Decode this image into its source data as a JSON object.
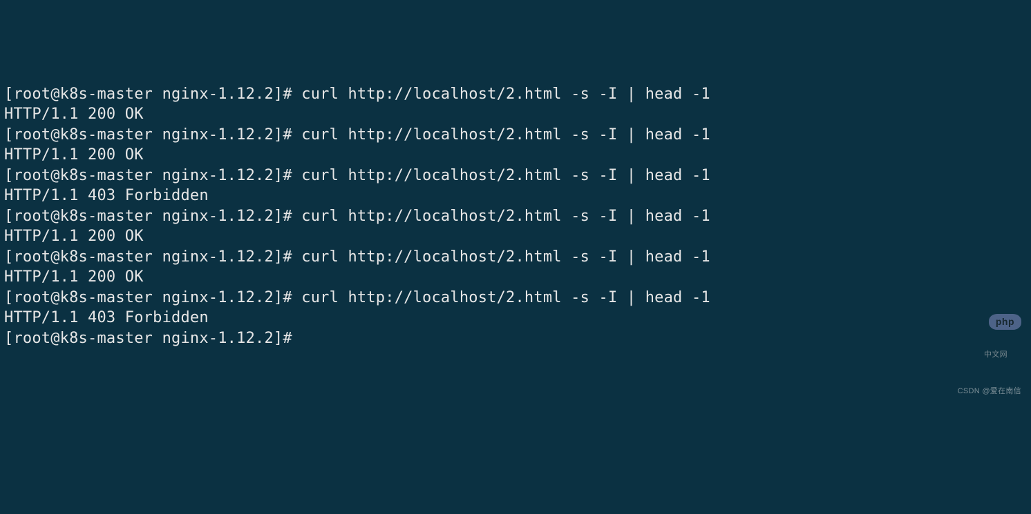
{
  "terminal": {
    "entries": [
      {
        "prompt": "[root@k8s-master nginx-1.12.2]# ",
        "command": "curl http://localhost/2.html -s -I | head -1",
        "output": "HTTP/1.1 200 OK"
      },
      {
        "prompt": "[root@k8s-master nginx-1.12.2]# ",
        "command": "curl http://localhost/2.html -s -I | head -1",
        "output": "HTTP/1.1 200 OK"
      },
      {
        "prompt": "[root@k8s-master nginx-1.12.2]# ",
        "command": "curl http://localhost/2.html -s -I | head -1",
        "output": "HTTP/1.1 403 Forbidden"
      },
      {
        "prompt": "[root@k8s-master nginx-1.12.2]# ",
        "command": "curl http://localhost/2.html -s -I | head -1",
        "output": "HTTP/1.1 200 OK"
      },
      {
        "prompt": "[root@k8s-master nginx-1.12.2]# ",
        "command": "curl http://localhost/2.html -s -I | head -1",
        "output": "HTTP/1.1 200 OK"
      },
      {
        "prompt": "[root@k8s-master nginx-1.12.2]# ",
        "command": "curl http://localhost/2.html -s -I | head -1",
        "output": "HTTP/1.1 403 Forbidden"
      }
    ],
    "final_prompt": "[root@k8s-master nginx-1.12.2]# "
  },
  "watermarks": {
    "php_label": "php",
    "php_cn": "中文网",
    "csdn": "CSDN @爱在南信"
  }
}
